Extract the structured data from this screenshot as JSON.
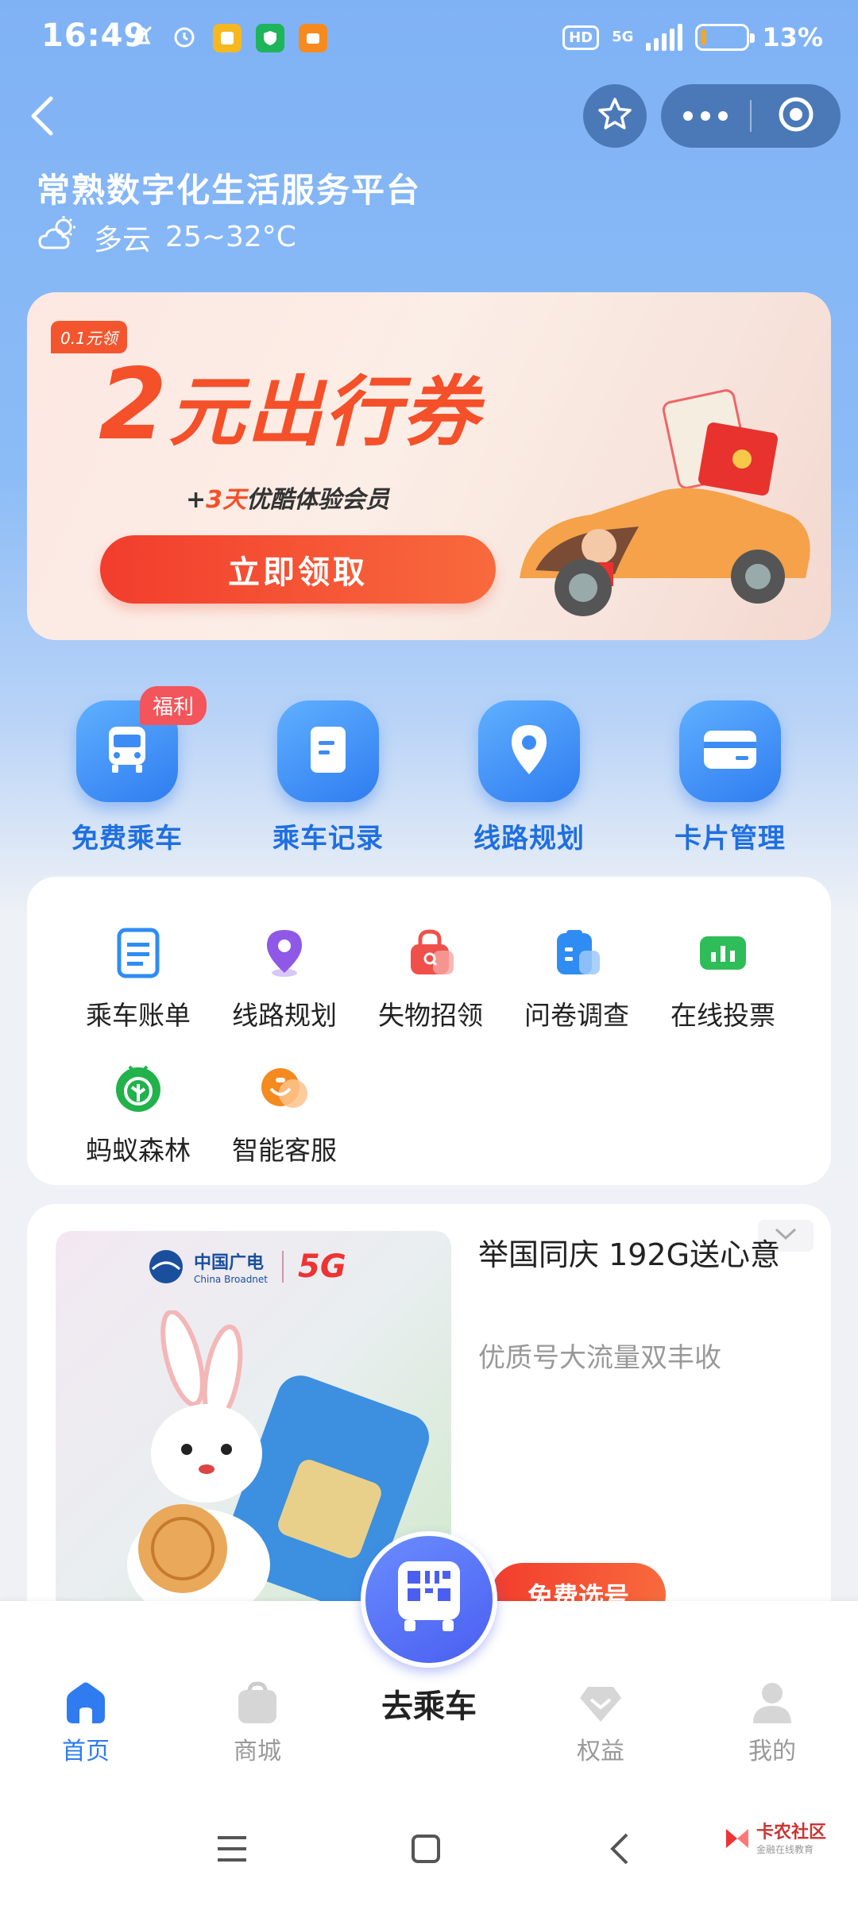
{
  "status_bar": {
    "time": "16:49",
    "network_badge": "HD",
    "network_type": "5G",
    "battery_percent": "13%",
    "battery_level": 0.13
  },
  "header": {
    "title": "常熟数字化生活服务平台",
    "weather_condition": "多云",
    "temperature": "25~32°C"
  },
  "banner": {
    "tag": "0.1元领",
    "headline_number": "2",
    "headline_text": "元出行券",
    "sub_prefix": "+",
    "sub_highlight": "3天",
    "sub_text": "优酷体验会员",
    "cta": "立即领取"
  },
  "quick_entries": [
    {
      "label": "免费乘车",
      "badge": "福利",
      "icon": "bus-icon"
    },
    {
      "label": "乘车记录",
      "icon": "record-icon"
    },
    {
      "label": "线路规划",
      "icon": "location-pin-icon"
    },
    {
      "label": "卡片管理",
      "icon": "card-icon"
    }
  ],
  "services": [
    {
      "label": "乘车账单",
      "icon": "bill-icon"
    },
    {
      "label": "线路规划",
      "icon": "route-icon"
    },
    {
      "label": "失物招领",
      "icon": "lost-found-icon"
    },
    {
      "label": "问卷调查",
      "icon": "survey-icon"
    },
    {
      "label": "在线投票",
      "icon": "vote-icon"
    },
    {
      "label": "蚂蚁森林",
      "icon": "ant-forest-icon"
    },
    {
      "label": "智能客服",
      "icon": "customer-service-icon"
    }
  ],
  "promo": {
    "brand_cn": "中国广电",
    "brand_en": "China Broadnet",
    "brand_5g": "5G",
    "title": "举国同庆 192G送心意",
    "desc": "优质号大流量双丰收",
    "button": "免费选号"
  },
  "tabbar": {
    "center_label": "去乘车",
    "tabs": [
      {
        "label": "首页",
        "active": true
      },
      {
        "label": "商城",
        "active": false
      },
      {
        "label": "权益",
        "active": false
      },
      {
        "label": "我的",
        "active": false
      }
    ]
  },
  "watermark": {
    "text": "卡农社区",
    "sub": "金融在线教育"
  },
  "colors": {
    "accent": "#2f7cf0",
    "promo_red": "#f4502a"
  }
}
